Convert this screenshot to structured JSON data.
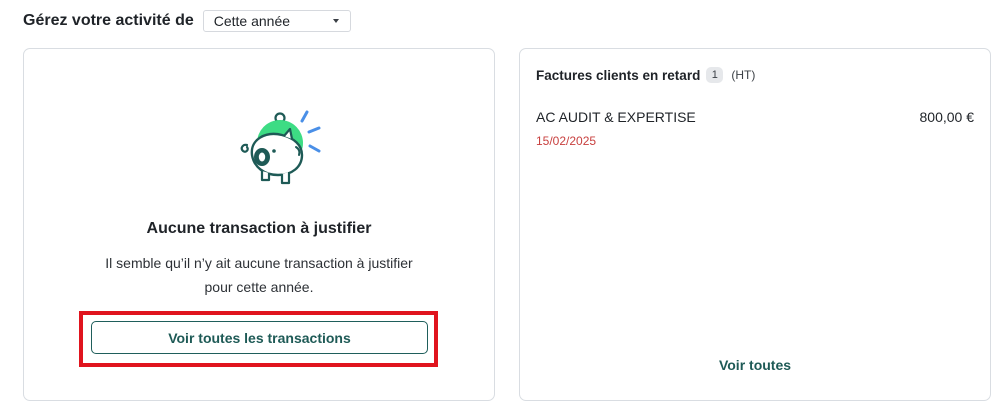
{
  "header": {
    "title": "Gérez votre activité de",
    "period_select": {
      "value": "Cette année"
    }
  },
  "transactions_card": {
    "illustration": "piggy-bank-illustration",
    "title": "Aucune transaction à justifier",
    "description_lines": [
      "Il semble qu’il n’y ait aucune transaction à justifier",
      "pour cette année."
    ],
    "button_label": "Voir toutes les transactions"
  },
  "invoices_card": {
    "title": "Factures clients en retard",
    "count": "1",
    "tax_label": "(HT)",
    "invoices": [
      {
        "client": "AC AUDIT & EXPERTISE",
        "amount": "800,00 €",
        "date": "15/02/2025"
      }
    ],
    "view_all_label": "Voir toutes"
  },
  "colors": {
    "brand_dark_green": "#1e5a56",
    "illustration_green": "#3ddc84",
    "illustration_blue": "#4a8fe7",
    "overdue_red": "#c8403f",
    "highlight_red": "#e0141e"
  }
}
